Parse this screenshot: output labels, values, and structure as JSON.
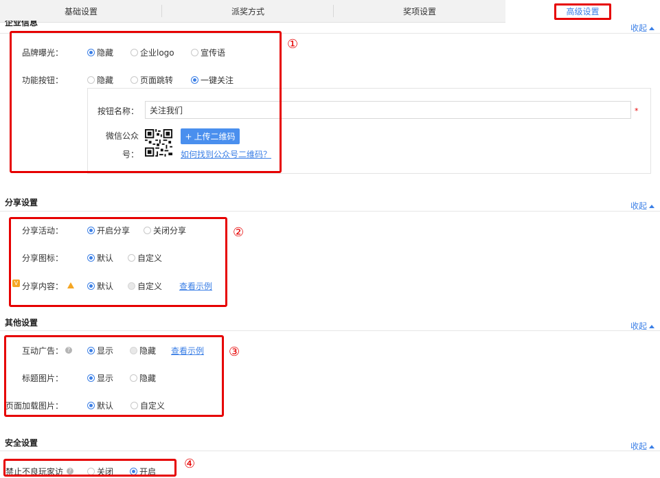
{
  "tabs": [
    {
      "label": "基础设置"
    },
    {
      "label": "派奖方式"
    },
    {
      "label": "奖项设置"
    },
    {
      "label": "高级设置"
    }
  ],
  "collapse_label": "收起",
  "enterprise": {
    "title": "企业信息",
    "brand": {
      "label": "品牌曝光：",
      "options": [
        "隐藏",
        "企业logo",
        "宣传语"
      ],
      "selected": "隐藏"
    },
    "func": {
      "label": "功能按钮：",
      "options": [
        "隐藏",
        "页面跳转",
        "一键关注"
      ],
      "selected": "一键关注"
    },
    "button_name": {
      "label": "按钮名称：",
      "value": "关注我们",
      "required_mark": "*"
    },
    "wechat": {
      "label_line1": "微信公众",
      "label_line2": "号：",
      "upload_label": "上传二维码",
      "upload_icon": "+",
      "help_link": "如何找到公众号二维码？"
    }
  },
  "share": {
    "title": "分享设置",
    "activity": {
      "label": "分享活动：",
      "options": [
        "开启分享",
        "关闭分享"
      ],
      "selected": "开启分享"
    },
    "icon": {
      "label": "分享图标：",
      "options": [
        "默认",
        "自定义"
      ],
      "selected": "默认"
    },
    "content": {
      "label": "分享内容：",
      "options": [
        "默认",
        "自定义"
      ],
      "selected": "默认",
      "link": "查看示例"
    }
  },
  "other": {
    "title": "其他设置",
    "ad": {
      "label": "互动广告：",
      "options": [
        "显示",
        "隐藏"
      ],
      "selected": "显示",
      "link": "查看示例"
    },
    "title_img": {
      "label": "标题图片：",
      "options": [
        "显示",
        "隐藏"
      ],
      "selected": "显示"
    },
    "loading_img": {
      "label": "页面加载图片：",
      "options": [
        "默认",
        "自定义"
      ],
      "selected": "默认"
    }
  },
  "security": {
    "title": "安全设置",
    "block": {
      "label": "禁止不良玩家访",
      "options": [
        "关闭",
        "开启"
      ],
      "selected": "开启"
    }
  },
  "annotations": [
    "①",
    "②",
    "③",
    "④"
  ],
  "colors": {
    "accent": "#3b7fe6",
    "annotation_red": "#e60000",
    "warning": "#f5a623"
  }
}
